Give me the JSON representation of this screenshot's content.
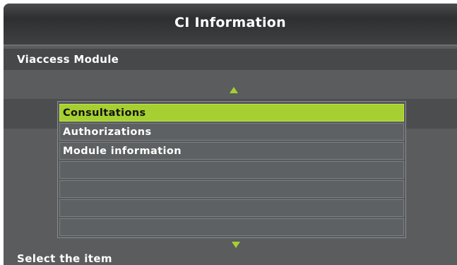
{
  "header": {
    "title": "CI Information"
  },
  "module": {
    "name": "Viaccess Module"
  },
  "menu": {
    "items": [
      {
        "label": "Consultations"
      },
      {
        "label": "Authorizations"
      },
      {
        "label": "Module information"
      },
      {
        "label": ""
      },
      {
        "label": ""
      },
      {
        "label": ""
      },
      {
        "label": ""
      }
    ],
    "selected_index": 0
  },
  "footer": {
    "hint": "Select the item"
  },
  "colors": {
    "accent": "#a6cf31",
    "background": "#5a5c5e",
    "title_bar": "#2e2f31",
    "text": "#ffffff"
  },
  "icons": {
    "scroll_up": "triangle-up-icon",
    "scroll_down": "triangle-down-icon"
  }
}
